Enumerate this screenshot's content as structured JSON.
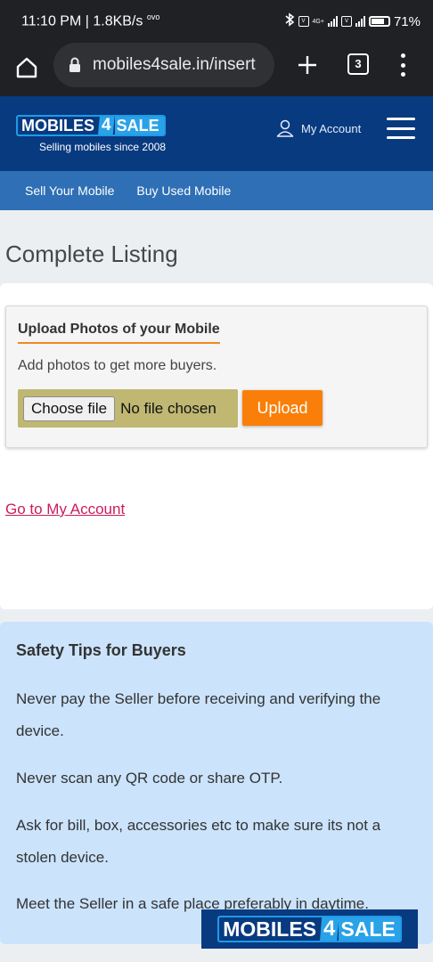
{
  "status_bar": {
    "time_speed": "11:10 PM | 1.8KB/s",
    "carrier_tag": "ovo",
    "network": "4G+",
    "battery": "71%"
  },
  "browser": {
    "url": "mobiles4sale.in/insert",
    "tab_count": "3"
  },
  "header": {
    "logo_part1": "MOBILES",
    "logo_part2": "4",
    "logo_part3": "SALE",
    "tagline": "Selling mobiles since 2008",
    "account_label": "My Account"
  },
  "nav": {
    "items": [
      {
        "label": "Sell Your Mobile"
      },
      {
        "label": "Buy Used Mobile"
      }
    ]
  },
  "main": {
    "title": "Complete Listing",
    "upload_heading": "Upload Photos of your Mobile",
    "upload_hint": "Add photos to get more buyers.",
    "choose_file_label": "Choose file",
    "no_file_label": "No file chosen",
    "upload_button": "Upload",
    "go_account_link": "Go to My Account"
  },
  "safety": {
    "title": "Safety Tips for Buyers",
    "tips": [
      "Never pay the Seller before receiving and verifying the device.",
      "Never scan any QR code or share OTP.",
      "Ask for bill, box, accessories etc to make sure its not a stolen device.",
      "Meet the Seller in a safe place preferably in daytime."
    ]
  },
  "colors": {
    "header_bg": "#083a80",
    "nav_bg": "#2e6fb6",
    "upload_button": "#f97f0a",
    "link": "#cb1c5e",
    "safety_bg": "#cbe3fb"
  }
}
